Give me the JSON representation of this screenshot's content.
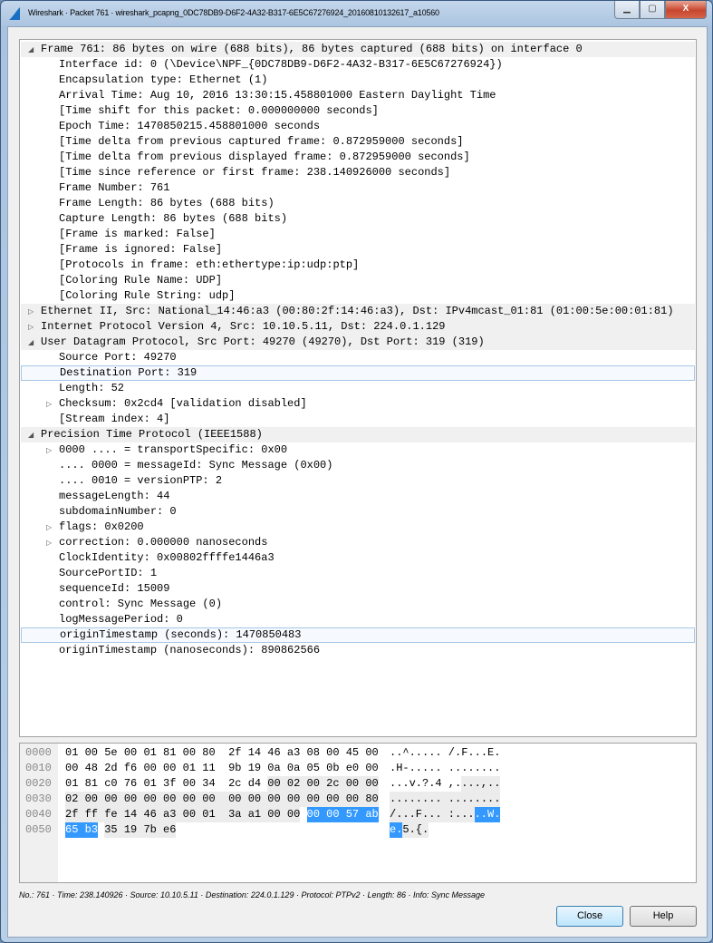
{
  "window": {
    "title": "Wireshark · Packet 761 · wireshark_pcapng_0DC78DB9-D6F2-4A32-B317-6E5C67276924_20160810132617_a10560",
    "minimize": "▁",
    "maximize": "▢",
    "close": "X"
  },
  "tree": [
    {
      "text": "Frame 761: 86 bytes on wire (688 bits), 86 bytes captured (688 bits) on interface 0",
      "level": 0,
      "expander": "expanded",
      "header": true
    },
    {
      "text": "Interface id: 0 (\\Device\\NPF_{0DC78DB9-D6F2-4A32-B317-6E5C67276924})",
      "level": 1
    },
    {
      "text": "Encapsulation type: Ethernet (1)",
      "level": 1
    },
    {
      "text": "Arrival Time: Aug 10, 2016 13:30:15.458801000 Eastern Daylight Time",
      "level": 1
    },
    {
      "text": "[Time shift for this packet: 0.000000000 seconds]",
      "level": 1
    },
    {
      "text": "Epoch Time: 1470850215.458801000 seconds",
      "level": 1
    },
    {
      "text": "[Time delta from previous captured frame: 0.872959000 seconds]",
      "level": 1
    },
    {
      "text": "[Time delta from previous displayed frame: 0.872959000 seconds]",
      "level": 1
    },
    {
      "text": "[Time since reference or first frame: 238.140926000 seconds]",
      "level": 1
    },
    {
      "text": "Frame Number: 761",
      "level": 1
    },
    {
      "text": "Frame Length: 86 bytes (688 bits)",
      "level": 1
    },
    {
      "text": "Capture Length: 86 bytes (688 bits)",
      "level": 1
    },
    {
      "text": "[Frame is marked: False]",
      "level": 1
    },
    {
      "text": "[Frame is ignored: False]",
      "level": 1
    },
    {
      "text": "[Protocols in frame: eth:ethertype:ip:udp:ptp]",
      "level": 1
    },
    {
      "text": "[Coloring Rule Name: UDP]",
      "level": 1
    },
    {
      "text": "[Coloring Rule String: udp]",
      "level": 1
    },
    {
      "text": "Ethernet II, Src: National_14:46:a3 (00:80:2f:14:46:a3), Dst: IPv4mcast_01:81 (01:00:5e:00:01:81)",
      "level": 0,
      "expander": "collapsed",
      "header": true
    },
    {
      "text": "Internet Protocol Version 4, Src: 10.10.5.11, Dst: 224.0.1.129",
      "level": 0,
      "expander": "collapsed",
      "header": true
    },
    {
      "text": "User Datagram Protocol, Src Port: 49270 (49270), Dst Port: 319 (319)",
      "level": 0,
      "expander": "expanded",
      "header": true
    },
    {
      "text": "Source Port: 49270",
      "level": 1
    },
    {
      "text": "Destination Port: 319",
      "level": 1,
      "selected": true
    },
    {
      "text": "Length: 52",
      "level": 1
    },
    {
      "text": "Checksum: 0x2cd4 [validation disabled]",
      "level": 1,
      "expander": "collapsed"
    },
    {
      "text": "[Stream index: 4]",
      "level": 1
    },
    {
      "text": "Precision Time Protocol (IEEE1588)",
      "level": 0,
      "expander": "expanded",
      "header": true
    },
    {
      "text": "0000 .... = transportSpecific: 0x00",
      "level": 1,
      "expander": "collapsed"
    },
    {
      "text": ".... 0000 = messageId: Sync Message (0x00)",
      "level": 1
    },
    {
      "text": ".... 0010 = versionPTP: 2",
      "level": 1
    },
    {
      "text": "messageLength: 44",
      "level": 1
    },
    {
      "text": "subdomainNumber: 0",
      "level": 1
    },
    {
      "text": "flags: 0x0200",
      "level": 1,
      "expander": "collapsed"
    },
    {
      "text": "correction: 0.000000 nanoseconds",
      "level": 1,
      "expander": "collapsed"
    },
    {
      "text": "ClockIdentity: 0x00802ffffe1446a3",
      "level": 1
    },
    {
      "text": "SourcePortID: 1",
      "level": 1
    },
    {
      "text": "sequenceId: 15009",
      "level": 1
    },
    {
      "text": "control: Sync Message (0)",
      "level": 1
    },
    {
      "text": "logMessagePeriod: 0",
      "level": 1
    },
    {
      "text": "originTimestamp (seconds): 1470850483",
      "level": 1,
      "selected": true
    },
    {
      "text": "originTimestamp (nanoseconds): 890862566",
      "level": 1
    }
  ],
  "hex": {
    "rows": [
      {
        "offset": "0000",
        "bytes": "01 00 5e 00 01 81 00 80 2f 14 46 a3 08 00 45 00",
        "ascii": "..^..... /.F...E."
      },
      {
        "offset": "0010",
        "bytes": "00 48 2d f6 00 00 01 11 9b 19 0a 0a 05 0b e0 00",
        "ascii": ".H-..... ........"
      },
      {
        "offset": "0020",
        "bytes": "01 81 c0 76 01 3f 00 34 2c d4 00 02 00 2c 00 00",
        "ascii": "...v.?.4 ,....,.."
      },
      {
        "offset": "0030",
        "bytes": "02 00 00 00 00 00 00 00 00 00 00 00 00 00 00 80",
        "ascii": "........ ........"
      },
      {
        "offset": "0040",
        "bytes": "2f ff fe 14 46 a3 00 01 3a a1 00 00 00 00 57 ab",
        "ascii": "/...F... :.....W."
      },
      {
        "offset": "0050",
        "bytes": "65 b3 35 19 7b e6",
        "ascii": "e.5.{."
      }
    ],
    "layer_range": [
      42,
      86
    ],
    "selected_range": [
      76,
      82
    ],
    "layer_color": "#ececec",
    "selected_color": "#3399ff"
  },
  "status": "No.: 761 · Time: 238.140926 · Source: 10.10.5.11 · Destination: 224.0.1.129 · Protocol: PTPv2 · Length: 86 · Info: Sync Message",
  "buttons": {
    "close": "Close",
    "help": "Help"
  }
}
